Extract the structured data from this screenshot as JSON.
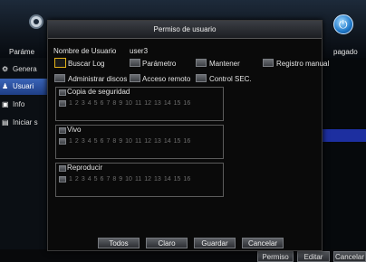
{
  "background": {
    "left_tab_label": "Paráme",
    "right_tab_label": "pagado",
    "sidebar": [
      {
        "icon": "gear-icon",
        "label": "Genera"
      },
      {
        "icon": "user-icon",
        "label": "Usuari",
        "active": true
      },
      {
        "icon": "info-icon",
        "label": "Info"
      },
      {
        "icon": "start-icon",
        "label": "Iniciar s"
      }
    ],
    "bottom_buttons": [
      "Permiso",
      "Editar",
      "Cancelar"
    ]
  },
  "dialog": {
    "title": "Permiso de usuario",
    "user_label": "Nombre de Usuario",
    "user_value": "user3",
    "permissions_row1": [
      "Buscar Log",
      "Parámetro",
      "Mantener",
      "Registro manual"
    ],
    "permissions_row2": [
      "Administrar discos",
      "Acceso remoto",
      "Control SEC."
    ],
    "groups": [
      {
        "title": "Copia de seguridad"
      },
      {
        "title": "Vivo"
      },
      {
        "title": "Reproducir"
      }
    ],
    "channels": [
      "1",
      "2",
      "3",
      "4",
      "5",
      "6",
      "7",
      "8",
      "9",
      "10",
      "11",
      "12",
      "13",
      "14",
      "15",
      "16"
    ],
    "buttons": {
      "all": "Todos",
      "clear": "Claro",
      "save": "Guardar",
      "cancel": "Cancelar"
    }
  },
  "colors": {
    "focus": "#e3b21a",
    "active_tab": "#3a64b8",
    "selected_row": "#1d2fa0"
  }
}
